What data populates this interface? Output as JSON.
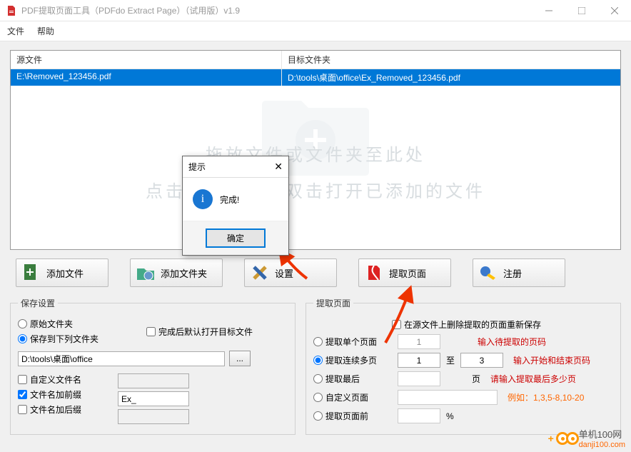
{
  "window": {
    "title": "PDF提取页面工具（PDFdo Extract Page）（试用版）v1.9"
  },
  "menu": {
    "file": "文件",
    "help": "帮助"
  },
  "columns": {
    "source": "源文件",
    "dest": "目标文件夹"
  },
  "files": [
    {
      "src": "E:\\Removed_123456.pdf",
      "dest": "D:\\tools\\桌面\\office\\Ex_Removed_123456.pdf"
    }
  ],
  "drop_hint": {
    "line1": "拖放文件或文件夹至此处",
    "line2": "点击添加文件或双击打开已添加的文件"
  },
  "toolbar": {
    "add_file": "添加文件",
    "add_folder": "添加文件夹",
    "settings": "设置",
    "extract": "提取页面",
    "register": "注册"
  },
  "save": {
    "legend": "保存设置",
    "open_after": "完成后默认打开目标文件",
    "orig_folder": "原始文件夹",
    "custom_folder": "保存到下列文件夹",
    "path": "D:\\tools\\桌面\\office",
    "browse": "...",
    "custom_name": "自定义文件名",
    "prefix": "文件名加前缀",
    "prefix_val": "Ex_",
    "suffix": "文件名加后缀"
  },
  "extract": {
    "legend": "提取页面",
    "resave": "在源文件上删除提取的页面重新保存",
    "single": "提取单个页面",
    "single_val": "1",
    "single_hint": "输入待提取的页码",
    "range": "提取连续多页",
    "range_from": "1",
    "range_to_label": "至",
    "range_to": "3",
    "range_hint": "输入开始和结束页码",
    "last": "提取最后",
    "last_unit": "页",
    "last_hint": "请输入提取最后多少页",
    "custom": "自定义页面",
    "custom_hint": "例如：1,3,5-8,10-20",
    "before": "提取页面前",
    "percent": "%"
  },
  "dialog": {
    "title": "提示",
    "message": "完成!",
    "ok": "确定"
  },
  "watermark": {
    "name": "单机100网",
    "url": "danji100.com"
  }
}
